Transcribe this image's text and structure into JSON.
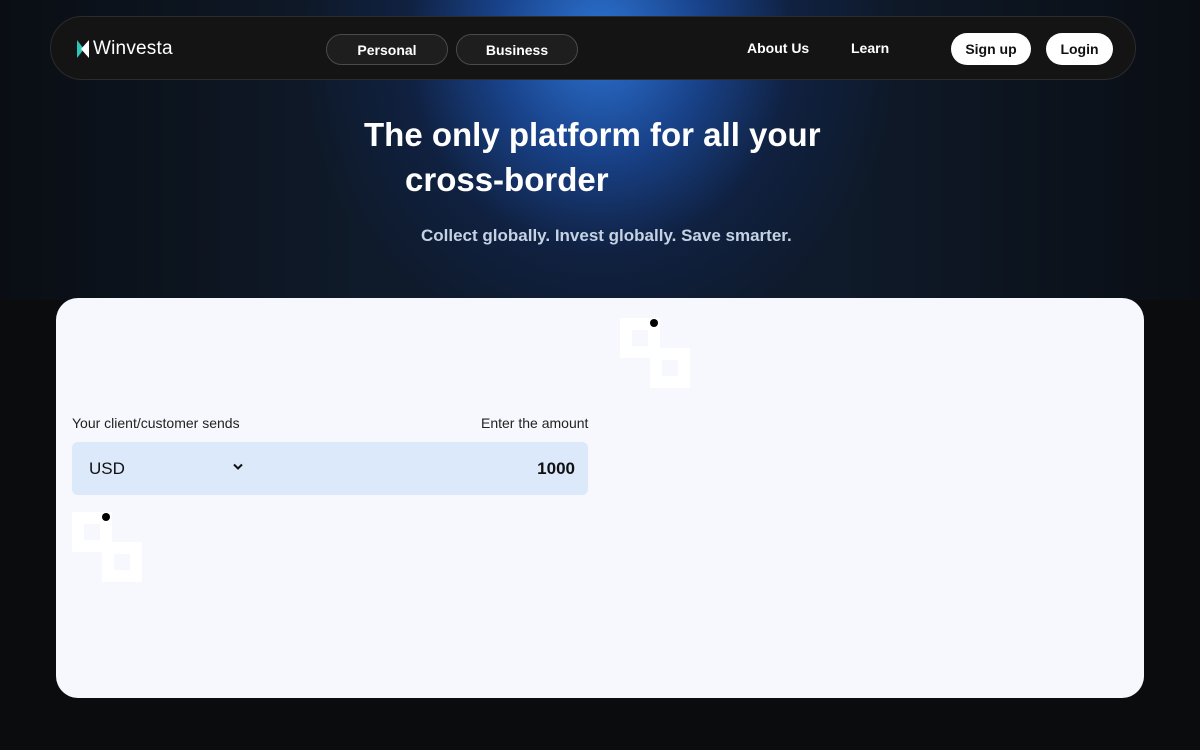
{
  "navbar": {
    "logo_text": "Winvesta",
    "personal_label": "Personal",
    "business_label": "Business",
    "about_label": "About Us",
    "learn_label": "Learn",
    "signup_label": "Sign up",
    "login_label": "Login"
  },
  "hero": {
    "title_line1": "The only platform for all your",
    "title_line2": "cross-border",
    "subtitle": "Collect globally. Invest globally. Save smarter."
  },
  "converter": {
    "sends_label": "Your client/customer sends",
    "amount_label": "Enter the amount",
    "currency": "USD",
    "amount": "1000"
  },
  "colors": {
    "accent_blue": "#2e78dc",
    "field_bg": "#dbe9fb",
    "card_bg": "#f6f8fd",
    "logo_teal": "#2ec4b6"
  },
  "icons": {
    "logo": "winvesta-logo-icon",
    "loader": "loading-spinner-icon",
    "dropdown": "chevron-down-icon"
  }
}
